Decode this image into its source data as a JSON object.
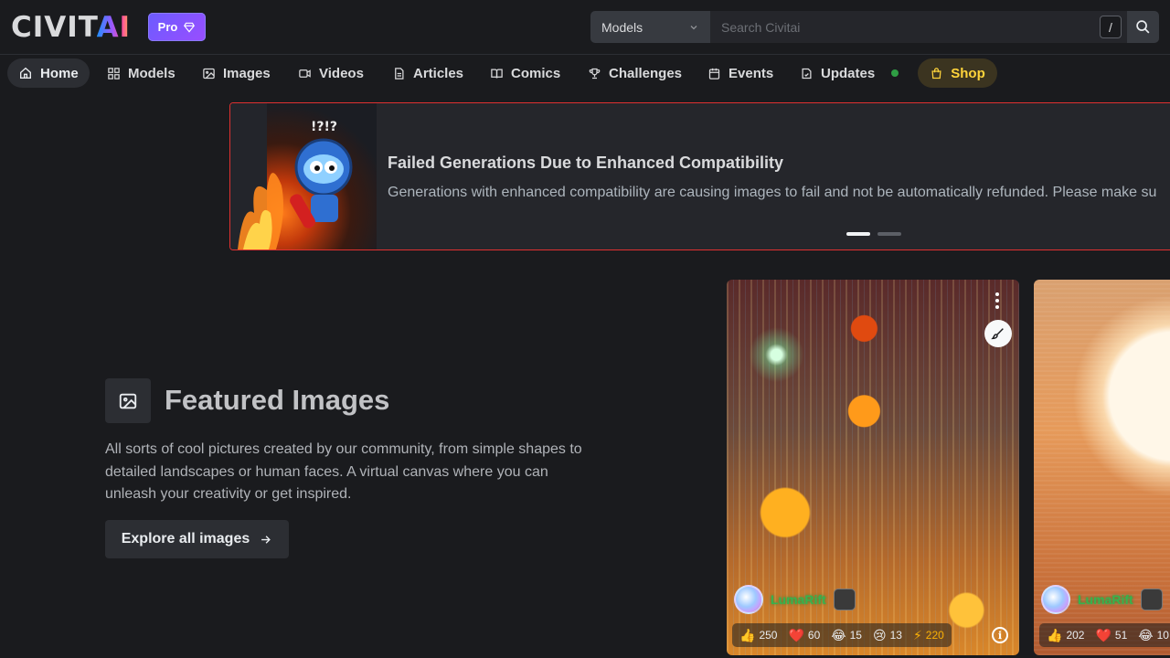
{
  "header": {
    "logo_main": "CIVIT",
    "logo_accent": "AI",
    "pro_label": "Pro",
    "search_scope": "Models",
    "search_placeholder": "Search Civitai",
    "shortcut_key": "/"
  },
  "nav": {
    "items": [
      {
        "label": "Home",
        "icon": "home-icon",
        "active": true
      },
      {
        "label": "Models",
        "icon": "grid-icon"
      },
      {
        "label": "Images",
        "icon": "photo-icon"
      },
      {
        "label": "Videos",
        "icon": "video-icon"
      },
      {
        "label": "Articles",
        "icon": "file-text-icon"
      },
      {
        "label": "Comics",
        "icon": "book-icon"
      },
      {
        "label": "Challenges",
        "icon": "trophy-icon"
      },
      {
        "label": "Events",
        "icon": "calendar-icon"
      },
      {
        "label": "Updates",
        "icon": "notes-icon",
        "has_dot": true
      },
      {
        "label": "Shop",
        "icon": "shopping-bag-icon",
        "highlight": true
      }
    ]
  },
  "banner": {
    "title": "Failed Generations Due to Enhanced Compatibility",
    "text": "Generations with enhanced compatibility are causing images to fail and not be automatically refunded. Please make su",
    "slide_count": 2,
    "active_slide": 1,
    "border_color": "#e03131"
  },
  "featured": {
    "title": "Featured Images",
    "description": "All sorts of cool pictures created by our community, from simple shapes to detailed landscapes or human faces. A virtual canvas where you can unleash your creativity or get inspired.",
    "cta": "Explore all images"
  },
  "cards": [
    {
      "username": "LumaRift",
      "stats": {
        "likes": "250",
        "hearts": "60",
        "laughs": "15",
        "cries": "13",
        "buzz": "220"
      }
    },
    {
      "username": "LumaRift",
      "stats": {
        "likes": "202",
        "hearts": "51",
        "laughs": "10"
      }
    }
  ],
  "colors": {
    "background": "#1a1b1e",
    "pro_gradient_start": "#6b5cff",
    "shop_text": "#ffd43b",
    "updates_dot": "#2f9e44",
    "username": "#37b24d",
    "buzz": "#fab005"
  }
}
